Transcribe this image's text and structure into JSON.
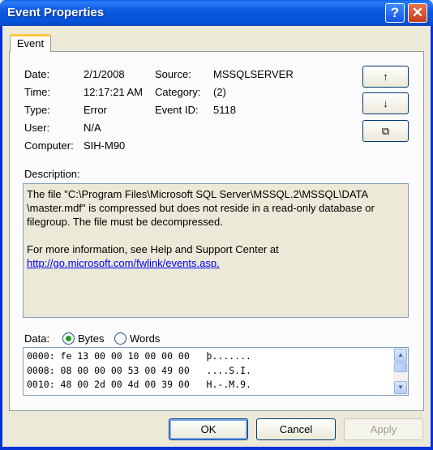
{
  "window": {
    "title": "Event Properties",
    "help_glyph": "?",
    "close_glyph": "✕"
  },
  "tab": {
    "label": "Event"
  },
  "fields": {
    "date_label": "Date:",
    "date_value": "2/1/2008",
    "time_label": "Time:",
    "time_value": "12:17:21 AM",
    "type_label": "Type:",
    "type_value": "Error",
    "user_label": "User:",
    "user_value": "N/A",
    "computer_label": "Computer:",
    "computer_value": "SIH-M90",
    "source_label": "Source:",
    "source_value": "MSSQLSERVER",
    "category_label": "Category:",
    "category_value": "(2)",
    "eventid_label": "Event ID:",
    "eventid_value": "5118"
  },
  "side_buttons": {
    "up_glyph": "↑",
    "down_glyph": "↓",
    "copy_glyph": "⧉"
  },
  "description": {
    "label": "Description:",
    "line1": "The file \"C:\\Program Files\\Microsoft SQL Server\\MSSQL.2\\MSSQL\\DATA",
    "line2": "\\master.mdf\" is compressed but does not reside in a read-only database or",
    "line3": "filegroup. The file must be decompressed.",
    "line4": "For more information, see Help and Support Center at",
    "link": "http://go.microsoft.com/fwlink/events.asp."
  },
  "data": {
    "label": "Data:",
    "bytes_label": "Bytes",
    "words_label": "Words",
    "selected": "Bytes",
    "rows": [
      "0000: fe 13 00 00 10 00 00 00   þ.......",
      "0008: 08 00 00 00 53 00 49 00   ....S.I.",
      "0010: 48 00 2d 00 4d 00 39 00   H.-.M.9."
    ]
  },
  "buttons": {
    "ok": "OK",
    "cancel": "Cancel",
    "apply": "Apply"
  },
  "colors": {
    "titlebar": "#0a5fe6",
    "tab_highlight": "#ffc83c",
    "link": "#0000ff",
    "dialog_bg": "#ece9d8"
  }
}
